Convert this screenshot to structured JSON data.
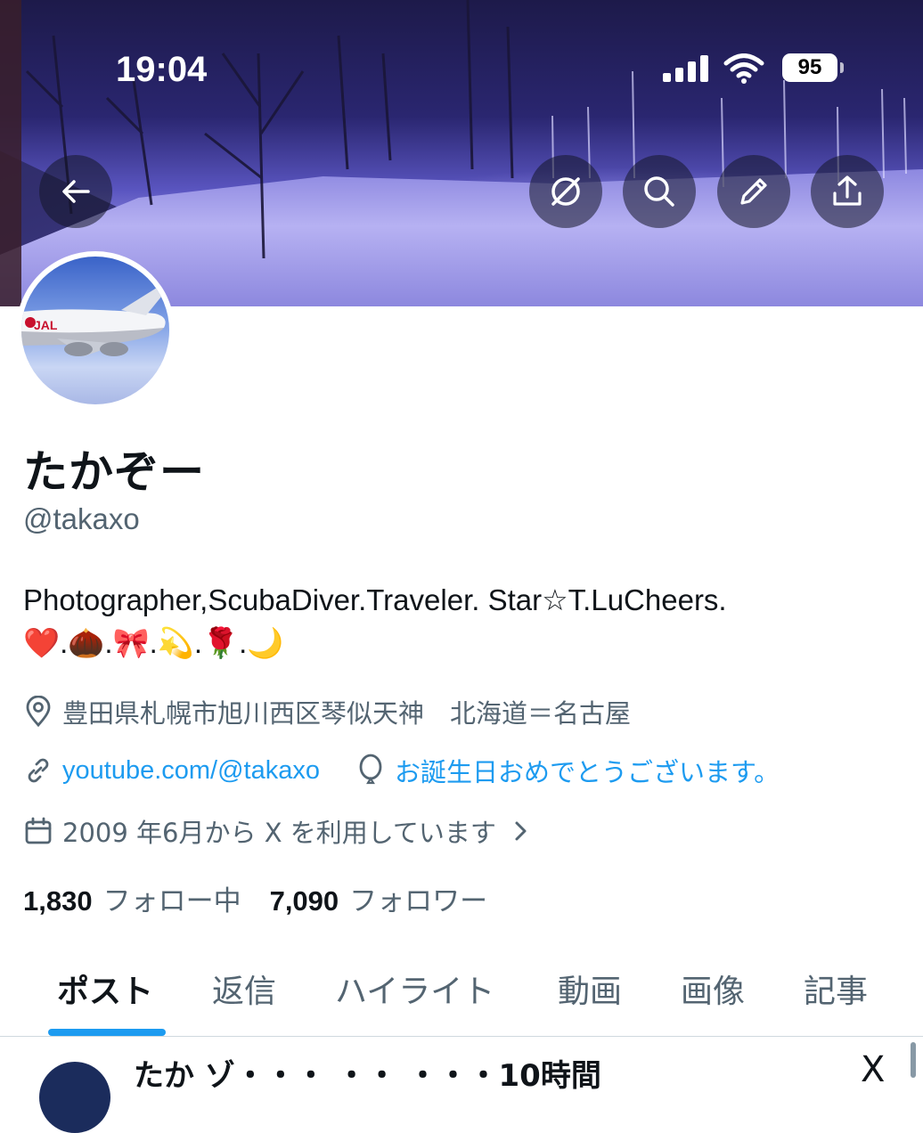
{
  "status_bar": {
    "time": "19:04",
    "battery": "95"
  },
  "header_actions": {
    "back_icon": "arrow-left-icon",
    "actions": [
      "no-grok-icon",
      "search-icon",
      "pencil-icon",
      "share-icon"
    ]
  },
  "profile": {
    "name": "たかぞー",
    "handle": "@takaxo",
    "bio_line1": "Photographer,ScubaDiver.Traveler. Star☆T.LuCheers.",
    "bio_line2": "❤️.🌰.🎀.💫.🌹.🌙",
    "location": "豊田県札幌市旭川西区琴似天神　北海道＝名古屋",
    "website": "youtube.com/@takaxo",
    "birthday": "お誕生日おめでとうございます。",
    "joined": "2009 年6月から X を利用しています",
    "following_count": "1,830",
    "following_label": "フォロー中",
    "followers_count": "7,090",
    "followers_label": "フォロワー"
  },
  "tabs": [
    {
      "label": "ポスト",
      "active": true
    },
    {
      "label": "返信"
    },
    {
      "label": "ハイライト"
    },
    {
      "label": "動画"
    },
    {
      "label": "画像"
    },
    {
      "label": "記事"
    }
  ],
  "peek": {
    "text": "たか ゾ・・・ ・・ ・・・10時間",
    "close_glyph": "X"
  },
  "colors": {
    "accent": "#1d9bf0",
    "secondary_text": "#536471",
    "primary_text": "#0f1419"
  }
}
